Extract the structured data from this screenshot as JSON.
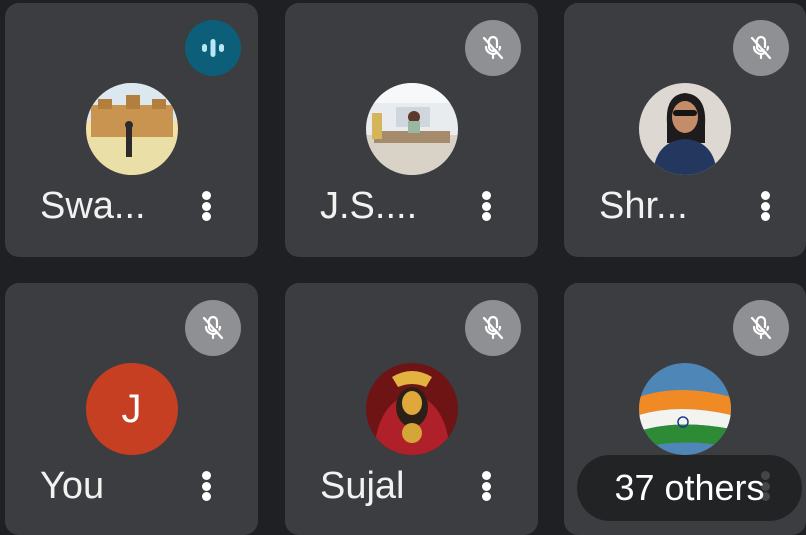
{
  "tiles": [
    {
      "name": "Swa...",
      "status": "speaking",
      "avatar": "photo-palace"
    },
    {
      "name": "J.S....",
      "status": "muted",
      "avatar": "photo-office"
    },
    {
      "name": "Shr...",
      "status": "muted",
      "avatar": "photo-girl-sunglasses"
    },
    {
      "name": "You",
      "status": "muted",
      "avatar_letter": "J",
      "avatar_color": "#c73f22"
    },
    {
      "name": "Sujal",
      "status": "muted",
      "avatar": "photo-deity"
    },
    {
      "name": "",
      "status": "muted",
      "avatar": "photo-india-flag"
    }
  ],
  "others_chip": "37 others",
  "colors": {
    "background": "#1f2023",
    "tile": "#3c3d40",
    "speaking": "#0d5e78",
    "muted": "#8f9094"
  }
}
